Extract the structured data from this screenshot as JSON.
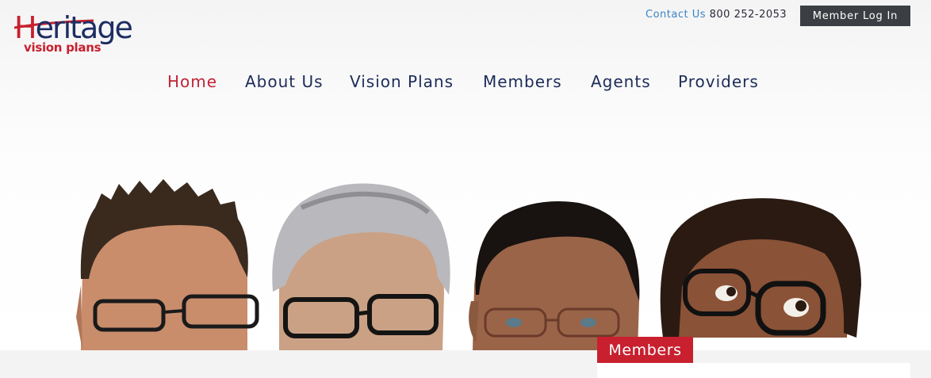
{
  "header": {
    "logo": {
      "first_letter": "H",
      "word_rest": "eritage",
      "subtitle": "vision plans"
    },
    "contact_label": "Contact Us",
    "phone": "800 252-2053",
    "login_label": "Member Log In"
  },
  "nav": {
    "items": [
      {
        "label": "Home",
        "active": true
      },
      {
        "label": "About Us",
        "active": false
      },
      {
        "label": "Vision Plans",
        "active": false
      },
      {
        "label": "Members",
        "active": false
      },
      {
        "label": "Agents",
        "active": false
      },
      {
        "label": "Providers",
        "active": false
      }
    ]
  },
  "hero": {
    "section_tab_label": "Members"
  },
  "colors": {
    "brand_red": "#c8202e",
    "brand_navy": "#1e2e63",
    "contact_blue": "#3a84c4",
    "login_bg": "#3b3e42"
  }
}
